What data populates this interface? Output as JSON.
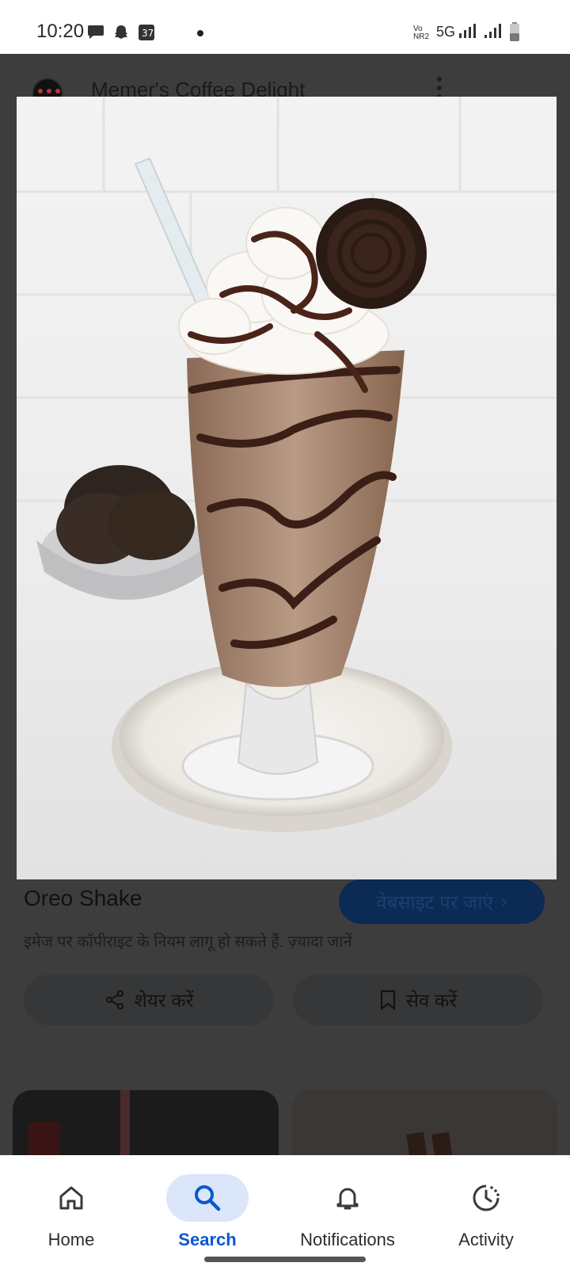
{
  "status_bar": {
    "time": "10:20",
    "network_label": "5G",
    "volte_label": "Vo NR2",
    "icons": [
      "message-icon",
      "snapchat-icon",
      "app-icon",
      "signal-icon",
      "battery-icon"
    ]
  },
  "header": {
    "channel_name": "Memer's Coffee Delight"
  },
  "image_viewer": {
    "title": "Oreo Shake",
    "visit_button": "वेबसाइट पर जाएं",
    "copyright_note": "इमेज पर कॉपीराइट के नियम लागू हो सकते हैं.",
    "learn_more": "ज़्यादा जानें",
    "share_label": "शेयर करें",
    "save_label": "सेव करें"
  },
  "bottom_nav": {
    "items": [
      {
        "label": "Home",
        "icon": "home-icon"
      },
      {
        "label": "Search",
        "icon": "search-icon",
        "active": true
      },
      {
        "label": "Notifications",
        "icon": "bell-icon"
      },
      {
        "label": "Activity",
        "icon": "activity-icon"
      }
    ]
  },
  "colors": {
    "accent": "#0b57d0",
    "active_pill": "#dbe6fb",
    "dim_overlay": "#3d3d3e"
  }
}
